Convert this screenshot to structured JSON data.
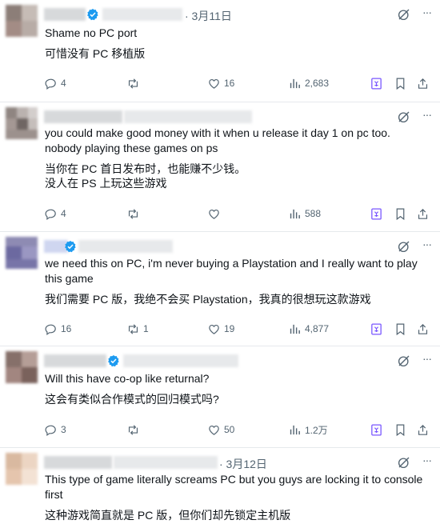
{
  "tweets": [
    {
      "date": "· 3月11日",
      "lines": [
        "Shame no PC port",
        "可惜没有 PC 移植版"
      ],
      "replies": "4",
      "reposts": "",
      "likes": "16",
      "views": "2,683"
    },
    {
      "date": "",
      "lines": [
        "you could make good money with it when u release it day 1 on pc too.",
        "nobody playing these games on ps",
        "当你在 PC 首日发布时，也能赚不少钱。",
        "没人在 PS 上玩这些游戏"
      ],
      "replies": "4",
      "reposts": "",
      "likes": "",
      "views": "588"
    },
    {
      "date": "",
      "lines": [
        "we need this on PC, i'm never buying a Playstation and I really want to play",
        "this game",
        "我们需要 PC 版，我绝不会买 Playstation，我真的很想玩这款游戏"
      ],
      "replies": "16",
      "reposts": "1",
      "likes": "19",
      "views": "4,877"
    },
    {
      "date": "",
      "lines": [
        "Will this have co-op like returnal?",
        "这会有类似合作模式的回归模式吗?"
      ],
      "replies": "3",
      "reposts": "",
      "likes": "50",
      "views": "1.2万"
    },
    {
      "date": "· 3月12日",
      "lines": [
        "This type of game literally screams PC but you guys are locking it to console",
        "first",
        "这种游戏简直就是 PC 版，但你们却先锁定主机版"
      ],
      "replies": "",
      "reposts": "",
      "likes": "",
      "views": ""
    }
  ],
  "colors": {
    "text": "#0f1419",
    "muted": "#536471",
    "verified": "#1d9bf0",
    "grok_purple": "#7856ff",
    "border": "#e6e9ec"
  },
  "icons": [
    "grok-icon",
    "more-icon",
    "reply-icon",
    "repost-icon",
    "like-icon",
    "views-icon",
    "grok-share-icon",
    "bookmark-icon",
    "share-icon",
    "verified-badge-icon"
  ]
}
